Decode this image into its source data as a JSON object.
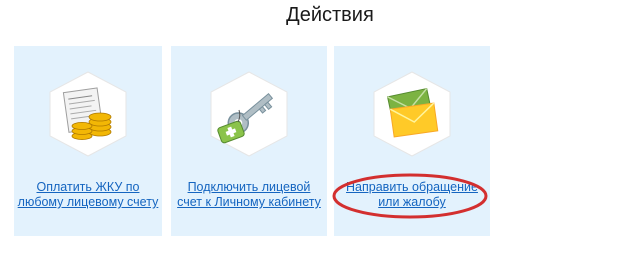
{
  "heading": "Действия",
  "actions": [
    {
      "line1": "Оплатить ЖКУ по",
      "line2": "любому лицевому счету",
      "icon": "receipt-coins-icon"
    },
    {
      "line1": "Подключить лицевой",
      "line2": "счет к Личному кабинету",
      "icon": "key-tag-icon"
    },
    {
      "line1": "Направить обращение",
      "line2": "или жалобу",
      "icon": "envelopes-icon"
    }
  ],
  "colors": {
    "card_bg": "#e3f2fd",
    "link": "#1565c0",
    "highlight_ring": "#d32f2f"
  }
}
